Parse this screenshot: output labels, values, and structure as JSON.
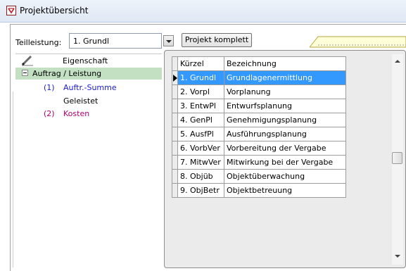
{
  "window": {
    "title": "Projektübersicht"
  },
  "toolbar": {
    "teilleistung_label": "Teilleistung:",
    "teilleistung_value": "1. Grundl",
    "projekt_button": "Projekt komplett"
  },
  "tree": {
    "header": "Eigenschaft",
    "group": "Auftrag / Leistung",
    "items": [
      {
        "num": "(1)",
        "label": "Auftr.-Summe",
        "color": "#1a1ad0"
      },
      {
        "num": "",
        "label": "Geleistet",
        "color": "#000000"
      },
      {
        "num": "(2)",
        "label": "Kosten",
        "color": "#b0006e"
      }
    ]
  },
  "dropdown": {
    "columns": [
      "Kürzel",
      "Bezeichnung"
    ],
    "rows": [
      {
        "k": "1. Grundl",
        "b": "Grundlagenermittlung"
      },
      {
        "k": "2. Vorpl",
        "b": "Vorplanung"
      },
      {
        "k": "3. EntwPl",
        "b": "Entwurfsplanung"
      },
      {
        "k": "4. GenPl",
        "b": "Genehmigungsplanung"
      },
      {
        "k": "5. AusfPl",
        "b": "Ausführungsplanung"
      },
      {
        "k": "6. VorbVer",
        "b": "Vorbereitung der Vergabe"
      },
      {
        "k": "7. MitwVer",
        "b": "Mitwirkung bei der Vergabe"
      },
      {
        "k": "8. Objüb",
        "b": "Objektüberwachung"
      },
      {
        "k": "9. ObjBetr",
        "b": "Objektbetreuung"
      }
    ],
    "selected_index": 0
  },
  "colors": {
    "selection": "#3399ff",
    "group_bg": "#c3e0c3",
    "tree_blue": "#1a1ad0",
    "tree_purple": "#b0006e"
  }
}
